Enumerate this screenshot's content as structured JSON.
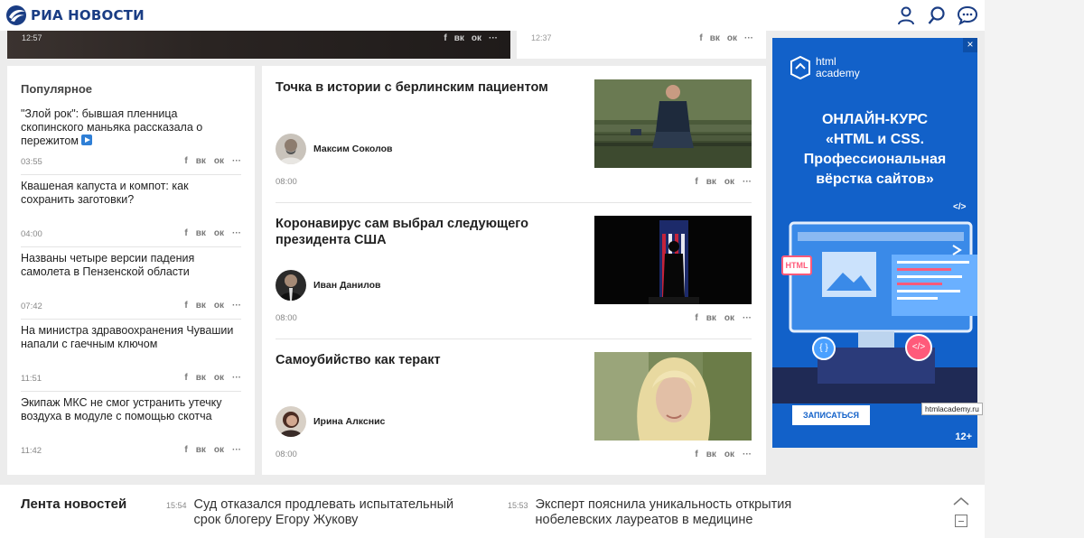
{
  "header": {
    "logo_text": "РИА НОВОСТИ",
    "icons": [
      "user-icon",
      "search-icon",
      "chat-icon"
    ]
  },
  "top_cards": [
    {
      "time": "12:57"
    },
    {
      "time": "12:37"
    }
  ],
  "social_labels": {
    "facebook": "f",
    "vk": "вк",
    "ok": "ок",
    "more": "···"
  },
  "popular": {
    "title": "Популярное",
    "items": [
      {
        "text": "\"Злой рок\": бывшая пленница скопинского маньяка рассказала о пережитом",
        "time": "03:55",
        "has_video": true
      },
      {
        "text": "Квашеная капуста и компот: как сохранить заготовки?",
        "time": "04:00"
      },
      {
        "text": "Названы четыре версии падения самолета в Пензенской области",
        "time": "07:42"
      },
      {
        "text": "На министра здравоохранения Чувашии напали с гаечным ключом",
        "time": "11:51"
      },
      {
        "text": "Экипаж МКС не смог устранить утечку воздуха в модуле с помощью скотча",
        "time": "11:42"
      }
    ]
  },
  "articles": [
    {
      "title": "Точка в истории с берлинским пациентом",
      "author": "Максим Соколов",
      "time": "08:00"
    },
    {
      "title": "Коронавирус сам выбрал следующего президента США",
      "author": "Иван Данилов",
      "time": "08:00"
    },
    {
      "title": "Самоубийство как теракт",
      "author": "Ирина Алкснис",
      "time": "08:00"
    }
  ],
  "ad": {
    "close": "×",
    "brand": "html academy",
    "brand_line1": "html",
    "brand_line2": "academy",
    "headline_line1": "ОНЛАЙН-КУРС",
    "headline_line2": "«HTML и CSS.",
    "headline_line3": "Профессиональная",
    "headline_line4": "вёрстка сайтов»",
    "badge_html": "HTML",
    "badge_curly": "{ }",
    "badge_code": "</>",
    "badge_code_small": "</>",
    "button": "ЗАПИСАТЬСЯ",
    "domain": "htmlacademy.ru",
    "age": "12+",
    "colors": {
      "background": "#1261c9"
    }
  },
  "lenta": {
    "title": "Лента новостей",
    "items": [
      {
        "time": "15:54",
        "text": "Суд отказался продлевать испытательный срок блогеру Егору Жукову"
      },
      {
        "time": "15:53",
        "text": "Эксперт пояснила уникальность открытия нобелевских лауреатов в медицине"
      }
    ]
  },
  "colors": {
    "brand": "#1a3d84",
    "link_blue": "#2f7fd6"
  }
}
